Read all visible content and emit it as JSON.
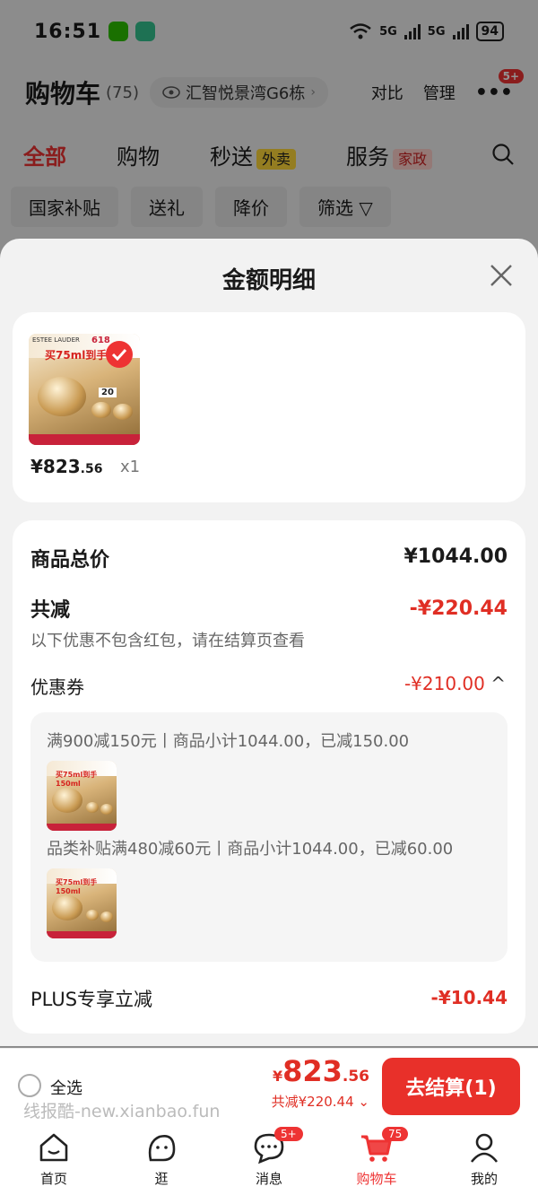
{
  "status": {
    "time": "16:51",
    "net1": "5G",
    "net2": "5G",
    "battery": "94"
  },
  "header": {
    "title": "购物车",
    "count": "(75)",
    "location": "汇智悦景湾G6栋",
    "compare": "对比",
    "manage": "管理",
    "badge": "5+"
  },
  "tabs": [
    {
      "label": "全部"
    },
    {
      "label": "购物"
    },
    {
      "label": "秒送",
      "tag": "外卖"
    },
    {
      "label": "服务",
      "tag": "家政"
    }
  ],
  "filters": [
    "国家补贴",
    "送礼",
    "降价",
    "筛选"
  ],
  "sheet": {
    "title": "金额明细",
    "item": {
      "brand": "ESTEE LAUDER",
      "event": "618",
      "promo": "买75ml到手150",
      "price_int": "823",
      "price_dec": ".56",
      "currency": "¥",
      "qty": "x1",
      "gift_tag": "20"
    },
    "total_label": "商品总价",
    "total_value": "¥1044.00",
    "discount_label": "共减",
    "discount_value": "-¥220.44",
    "discount_note": "以下优惠不包含红包，请在结算页查看",
    "coupon_label": "优惠券",
    "coupon_value": "-¥210.00",
    "coupon_lines": [
      "满900减150元丨商品小计1044.00，已减150.00",
      "品类补贴满480减60元丨商品小计1044.00，已减60.00"
    ],
    "thumb_promo": "买75ml到手150ml",
    "plus_label": "PLUS专享立减",
    "plus_value": "-¥10.44"
  },
  "bottom": {
    "select_all": "全选",
    "currency": "¥",
    "price_int": "823",
    "price_dec": ".56",
    "total_discount": "共减¥220.44",
    "checkout": "去结算(1)"
  },
  "watermark": "线报酷-new.xianbao.fun",
  "nav": [
    {
      "label": "首页",
      "icon": "home-icon"
    },
    {
      "label": "逛",
      "icon": "browse-icon"
    },
    {
      "label": "消息",
      "icon": "message-icon",
      "badge": "5+"
    },
    {
      "label": "购物车",
      "icon": "cart-icon",
      "badge": "75"
    },
    {
      "label": "我的",
      "icon": "profile-icon"
    }
  ],
  "colors": {
    "accent": "#e02e24",
    "checkout": "#e8302a",
    "tag_yellow": "#ffd83a"
  }
}
